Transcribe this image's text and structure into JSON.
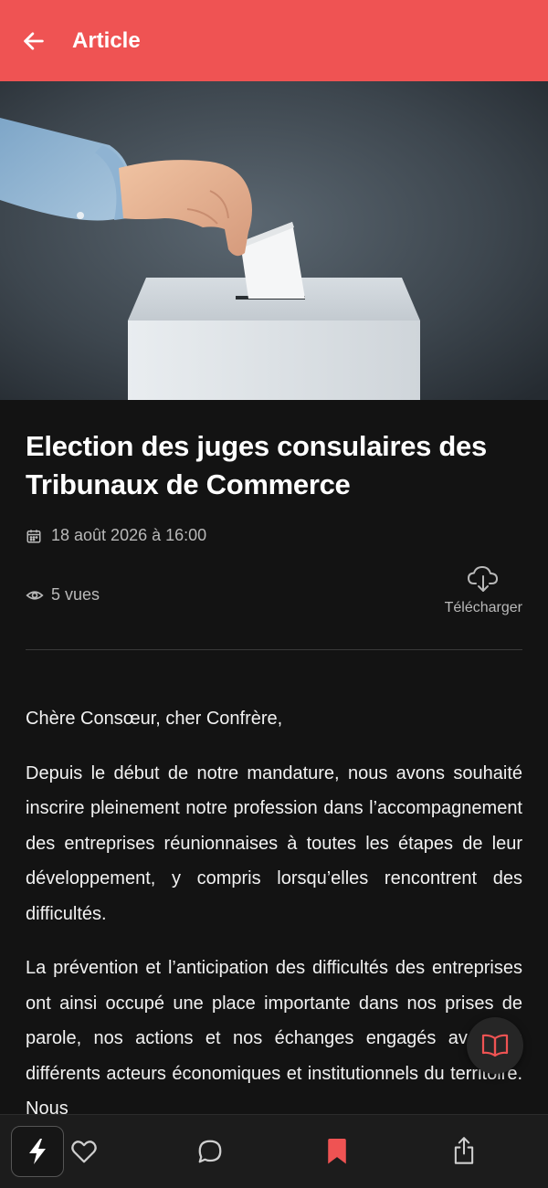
{
  "header": {
    "title": "Article",
    "back_icon": "arrow-left-icon",
    "background_color": "#ef5353"
  },
  "hero_image": {
    "subject": "hand-dropping-ballot-into-box"
  },
  "article": {
    "title": "Election des juges consulaires des Tribunaux de Commerce",
    "date": "18 août 2026 à 16:00",
    "views": "5 vues",
    "download_label": "Télécharger",
    "paragraphs": [
      "Chère Consœur, cher Confrère,",
      "Depuis le début de notre mandature, nous avons souhaité inscrire pleinement notre profession dans l’accompagnement des entreprises réunionnaises à toutes les étapes de leur développement, y compris lorsqu’elles rencontrent des difficultés.",
      "La prévention et l’anticipation des difficultés des entreprises ont ainsi occupé une place importante dans nos prises de parole, nos actions et nos échanges engagés avec les différents acteurs économiques et institutionnels du territoire. Nous"
    ]
  },
  "fab": {
    "icon": "book-open-icon"
  },
  "bottom_bar": {
    "items": [
      {
        "icon": "flash-icon"
      },
      {
        "icon": "heart-icon"
      },
      {
        "icon": "comment-icon"
      },
      {
        "icon": "bookmark-icon",
        "active": true
      },
      {
        "icon": "share-icon"
      }
    ]
  },
  "colors": {
    "accent": "#ef5353",
    "background": "#131313",
    "muted_text": "#b9b9b9"
  }
}
